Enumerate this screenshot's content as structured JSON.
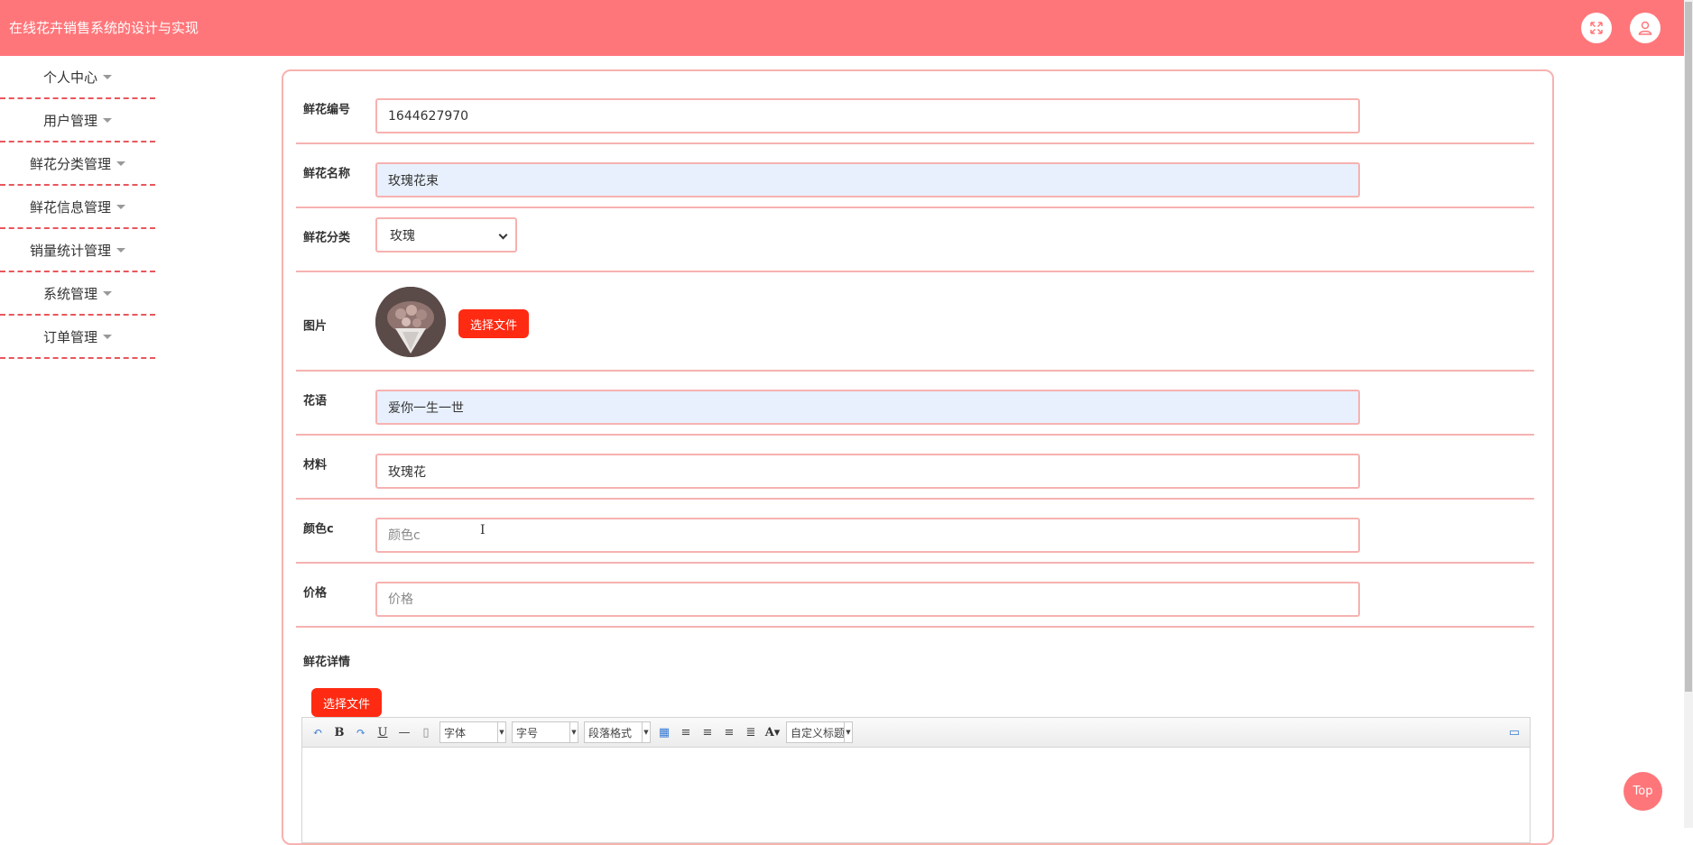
{
  "header": {
    "title": "在线花卉销售系统的设计与实现",
    "fullscreen_icon": "expand-icon",
    "user_icon": "user-icon",
    "background_color": "#ff767a"
  },
  "sidebar": {
    "items": [
      {
        "label": "个人中心"
      },
      {
        "label": "用户管理"
      },
      {
        "label": "鲜花分类管理"
      },
      {
        "label": "鲜花信息管理"
      },
      {
        "label": "销量统计管理"
      },
      {
        "label": "系统管理"
      },
      {
        "label": "订单管理"
      }
    ]
  },
  "form": {
    "flower_no": {
      "label": "鲜花编号",
      "value": "1644627970"
    },
    "flower_name": {
      "label": "鲜花名称",
      "value": "玫瑰花束"
    },
    "category": {
      "label": "鲜花分类",
      "value": "玫瑰"
    },
    "image": {
      "label": "图片",
      "button": "选择文件"
    },
    "language": {
      "label": "花语",
      "value": "爱你一生一世"
    },
    "material": {
      "label": "材料",
      "value": "玫瑰花"
    },
    "color": {
      "label": "颜色c",
      "placeholder": "颜色c"
    },
    "price": {
      "label": "价格",
      "placeholder": "价格"
    },
    "detail": {
      "label": "鲜花详情",
      "button": "选择文件"
    }
  },
  "editor": {
    "font_family": "字体",
    "font_size": "字号",
    "paragraph": "段落格式",
    "custom_title": "自定义标题"
  },
  "top_button": "Top",
  "colors": {
    "accent": "#ff767a",
    "border": "#f6b2b0",
    "button": "#ff2a12",
    "autofill": "#e8f0fe"
  }
}
